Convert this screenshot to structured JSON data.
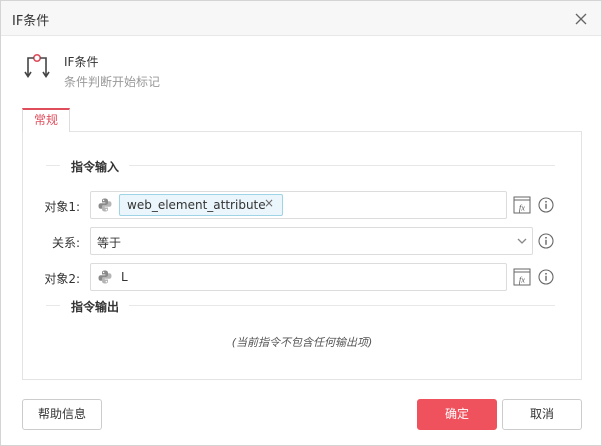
{
  "window": {
    "title": "IF条件"
  },
  "header": {
    "title": "IF条件",
    "subtitle": "条件判断开始标记",
    "icon": "if-condition-icon"
  },
  "tabs": [
    {
      "label": "常规",
      "active": true
    }
  ],
  "input_section": {
    "title": "指令输入",
    "object1": {
      "label": "对象1:",
      "tag": "web_element_attribute",
      "icon": "python-icon"
    },
    "relation": {
      "label": "关系:",
      "value": "等于"
    },
    "object2": {
      "label": "对象2:",
      "value": "L",
      "icon": "python-icon"
    }
  },
  "output_section": {
    "title": "指令输出",
    "empty_note": "(当前指令不包含任何输出项)"
  },
  "buttons": {
    "help": "帮助信息",
    "ok": "确定",
    "cancel": "取消"
  },
  "colors": {
    "accent": "#e04e5c",
    "primary_button": "#f0525d",
    "tag_border": "#9fd3e6",
    "tag_bg": "#eaf6fb"
  }
}
